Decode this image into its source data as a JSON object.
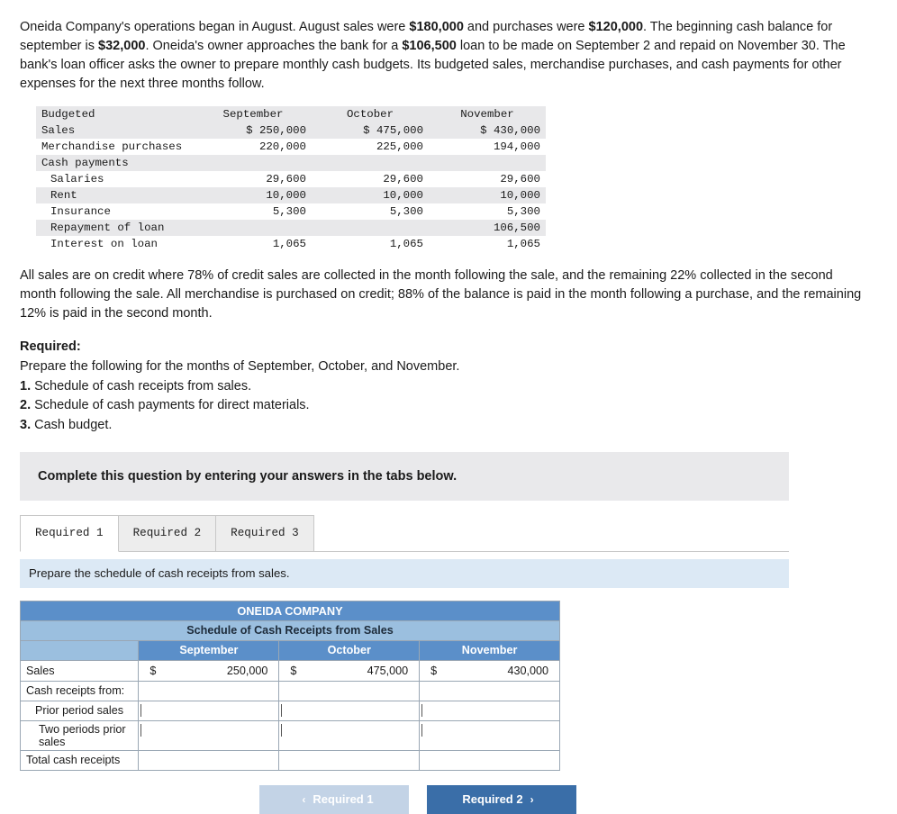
{
  "intro": {
    "text_parts": [
      "Oneida Company's operations began in August. August sales were ",
      "$180,000",
      " and purchases were ",
      "$120,000",
      ". The beginning cash balance for september is ",
      "$32,000",
      ". Oneida's owner approaches the bank for a ",
      "$106,500",
      " loan to be made on September 2 and repaid on November 30. The bank's loan officer asks the owner to prepare monthly cash budgets. Its budgeted sales, merchandise purchases, and cash payments for other expenses for the next three months follow."
    ]
  },
  "budget_table": {
    "headers": [
      "Budgeted",
      "September",
      "October",
      "November"
    ],
    "rows": [
      {
        "label": "Sales",
        "indent": 0,
        "shaded": true,
        "values": [
          "$ 250,000",
          "$ 475,000",
          "$ 430,000"
        ]
      },
      {
        "label": "Merchandise purchases",
        "indent": 0,
        "shaded": false,
        "values": [
          "220,000",
          "225,000",
          "194,000"
        ]
      },
      {
        "label": "Cash payments",
        "indent": 0,
        "shaded": true,
        "values": [
          "",
          "",
          ""
        ]
      },
      {
        "label": "Salaries",
        "indent": 1,
        "shaded": false,
        "values": [
          "29,600",
          "29,600",
          "29,600"
        ]
      },
      {
        "label": "Rent",
        "indent": 1,
        "shaded": true,
        "values": [
          "10,000",
          "10,000",
          "10,000"
        ]
      },
      {
        "label": "Insurance",
        "indent": 1,
        "shaded": false,
        "values": [
          "5,300",
          "5,300",
          "5,300"
        ]
      },
      {
        "label": "Repayment of loan",
        "indent": 1,
        "shaded": true,
        "values": [
          "",
          "",
          "106,500"
        ]
      },
      {
        "label": "Interest on loan",
        "indent": 1,
        "shaded": false,
        "values": [
          "1,065",
          "1,065",
          "1,065"
        ]
      }
    ]
  },
  "credit_paragraph": "All sales are on credit where 78% of credit sales are collected in the month following the sale, and the remaining 22% collected in the second month following the sale. All merchandise is purchased on credit; 88% of the balance is paid in the month following a purchase, and the remaining 12% is paid in the second month.",
  "required": {
    "title": "Required:",
    "lead": "Prepare the following for the months of September, October, and November.",
    "items": [
      {
        "num": "1.",
        "text": " Schedule of cash receipts from sales."
      },
      {
        "num": "2.",
        "text": " Schedule of cash payments for direct materials."
      },
      {
        "num": "3.",
        "text": " Cash budget."
      }
    ]
  },
  "banner": "Complete this question by entering your answers in the tabs below.",
  "tabs": [
    {
      "label": "Required 1",
      "active": true
    },
    {
      "label": "Required 2",
      "active": false
    },
    {
      "label": "Required 3",
      "active": false
    }
  ],
  "instruction": "Prepare the schedule of cash receipts from sales.",
  "answer_table": {
    "title": "ONEIDA COMPANY",
    "subtitle": "Schedule of Cash Receipts from Sales",
    "columns": [
      "September",
      "October",
      "November"
    ],
    "rows": [
      {
        "label": "Sales",
        "indent": 0,
        "type": "values",
        "cells": [
          {
            "dollar": "$",
            "amount": "250,000"
          },
          {
            "dollar": "$",
            "amount": "475,000"
          },
          {
            "dollar": "$",
            "amount": "430,000"
          }
        ]
      },
      {
        "label": "Cash receipts from:",
        "indent": 0,
        "type": "header",
        "cells": [
          {},
          {},
          {}
        ]
      },
      {
        "label": "Prior period sales",
        "indent": 1,
        "type": "input",
        "cells": [
          {
            "value": ""
          },
          {
            "value": ""
          },
          {
            "value": ""
          }
        ]
      },
      {
        "label": "Two periods prior sales",
        "indent": 1,
        "type": "input",
        "cells": [
          {
            "value": ""
          },
          {
            "value": ""
          },
          {
            "value": ""
          }
        ]
      },
      {
        "label": "Total cash receipts",
        "indent": 0,
        "type": "total",
        "cells": [
          {
            "value": ""
          },
          {
            "value": ""
          },
          {
            "value": ""
          }
        ]
      }
    ]
  },
  "nav": {
    "prev_label": "Required 1",
    "next_label": "Required 2",
    "prev_chevron": "‹",
    "next_chevron": "›"
  }
}
